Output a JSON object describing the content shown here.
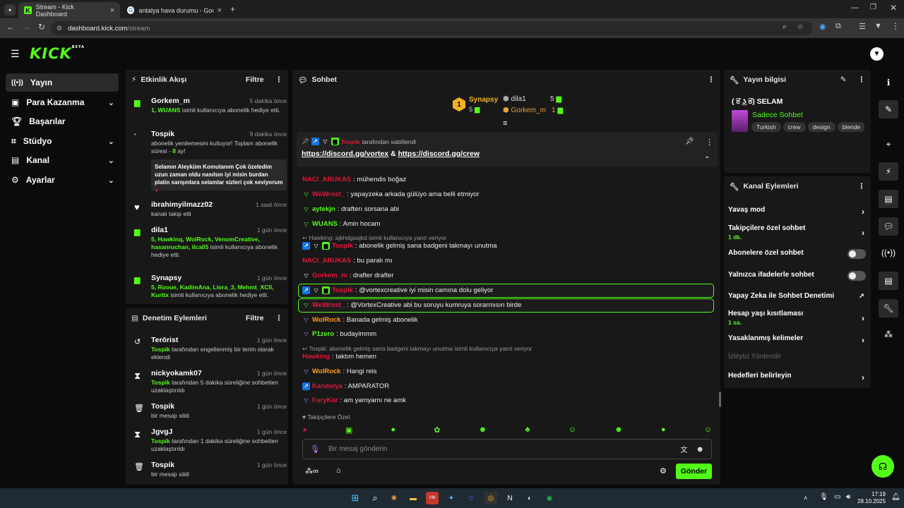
{
  "browser": {
    "tabs": [
      {
        "title": "Stream - Kick Dashboard"
      },
      {
        "title": "antalya hava durumu - Google"
      }
    ],
    "url_host": "dashboard.kick.com",
    "url_path": "/stream"
  },
  "kick": {
    "logo": "KICK",
    "beta": "BETA"
  },
  "nav": {
    "items": [
      {
        "label": "Yayın",
        "icon": "broadcast-icon"
      },
      {
        "label": "Para Kazanma",
        "icon": "money-icon"
      },
      {
        "label": "Başarılar",
        "icon": "trophy-icon"
      },
      {
        "label": "Stüdyo",
        "icon": "studio-icon"
      },
      {
        "label": "Kanal",
        "icon": "channel-icon"
      },
      {
        "label": "Ayarlar",
        "icon": "settings-icon"
      }
    ]
  },
  "activity": {
    "title": "Etkinlik Akışı",
    "filter": "Filtre",
    "events": [
      {
        "who": "Gorkem_m",
        "when": "5 dakika önce",
        "hl": "1, WUANS",
        "text": " isimli kullanıcıya abonelik hediye etti."
      },
      {
        "who": "Tospik",
        "when": "9 dakika önce",
        "text1": "abonelik yenilemesini kutluyor! Toplam abonelik süresi - ",
        "hl": "8",
        "text2": " ay!",
        "message": "Selamın Aleyküm Komutanım Çok özeledim uzun zaman oldu nasılsın iyi misin burdan platin sarışınlara selamlar sizleri çok seviyorum"
      },
      {
        "who": "ibrahimyilmazz02",
        "when": "1 saat önce",
        "text": "kanalı takip etti"
      },
      {
        "who": "dila1",
        "when": "1 gün önce",
        "hl": "5, Hawkinq, WolRock, VenomCreative, hasanruchan, ilca05",
        "text": "isimli kullanıcıya abonelik hediye etti."
      },
      {
        "who": "Synapsy",
        "when": "1 gün önce",
        "hl": "5, Rooue, KadimAna, Liora_3, Mehmt_XClI, Kurttx",
        "text": "isimli kullanıcıya abonelik hediye etti."
      }
    ]
  },
  "moderation": {
    "title": "Denetim Eylemleri",
    "filter": "Filtre",
    "items": [
      {
        "who": "Terörist",
        "when": "1 gün önce",
        "by": "Tospik",
        "text": " tarafından engellenmiş bir terim olarak eklendi"
      },
      {
        "who": "nickyokamk07",
        "when": "1 gün önce",
        "by": "Tospik",
        "text": " tarafından 5 dakika süreliğine sohbetten uzaklaştırıldı"
      },
      {
        "who": "Tospik",
        "when": "1 gün önce",
        "text": "bir mesajı sildi"
      },
      {
        "who": "JgvgJ",
        "when": "1 gün önce",
        "by": "Tospik",
        "text": " tarafından 1 dakika süreliğine sohbetten uzaklaştırıldı"
      },
      {
        "who": "Tospik",
        "when": "1 gün önce",
        "text": "bir mesajı sildi"
      }
    ]
  },
  "chat": {
    "title": "Sohbet",
    "leaderboard": {
      "first": {
        "rank": "1",
        "name": "Synapsy",
        "count": "5"
      },
      "second": {
        "name": "dila1",
        "count": "5"
      },
      "third": {
        "name": "Gorkem_m",
        "count": "1"
      }
    },
    "pinned": {
      "by": "Tospik",
      "suffix": " tarafından sabitlendi",
      "link1": "https://discord.gg/vortex",
      "amp": " & ",
      "link2": "https://discord.gg/crew"
    },
    "messages": [
      {
        "user": "NACI_ARUKAS",
        "color": "#e8133b",
        "text": ": mühendis boğaz"
      },
      {
        "user": "WeWrost_",
        "color": "#e8133b",
        "text": ": yapayzeka arkada gülüyo ama belli etmiyor"
      },
      {
        "user": "aytekjn",
        "color": "#53fc18",
        "text": ": drafterı sorsana abi"
      },
      {
        "user": "WUANS",
        "color": "#53fc18",
        "text": ": Amin hocam"
      },
      {
        "reply": "Hawking: ajkhdgasjkd isimli kullanıcıya yanıt veriyor"
      },
      {
        "user": "Tospik",
        "color": "#e8133b",
        "text": ": abonelik gelmiş sana badgeni takmayı unutma"
      },
      {
        "user": "NACI_ARUKAS",
        "color": "#e8133b",
        "text": ": bu paralı mı"
      },
      {
        "user": "Gorkem_m",
        "color": "#e8133b",
        "text": ": drafter drafter"
      },
      {
        "user": "Tospik",
        "color": "#e8133b",
        "text": ": @vortexcreative iyi misin camına dolu geliyor"
      },
      {
        "user": "WeWrost_",
        "color": "#e8133b",
        "text": ": @VortexCreative abi bu soruyu kumruya sorarmısın birde"
      },
      {
        "user": "WolRock",
        "color": "#ff9f1c",
        "text": ": Banada gelmiş abonelik"
      },
      {
        "user": "P1zero",
        "color": "#53fc18",
        "text": ": budayimmm"
      },
      {
        "reply": "Tospik: abonelik gelmiş sana badgeni takmayı unutma isimli kullanıcıya yanıt veriyor"
      },
      {
        "user": "Hawking",
        "color": "#e8133b",
        "text": ": taktım hemen"
      },
      {
        "user": "WolRock",
        "color": "#ff9f1c",
        "text": ": Hangi reis"
      },
      {
        "user": "Kandolya",
        "color": "#e8133b",
        "text": ": AMPARATOR"
      },
      {
        "user": "FuryKar",
        "color": "#e8133b",
        "text": ": am yamyamı ne amk"
      }
    ],
    "followers_only": "Takipçilere Özel",
    "input_placeholder": "Bir mesaj gönderin",
    "send": "Gönder"
  },
  "stream_info": {
    "title": "Yayın bilgisi",
    "stream_title": "( ͡ಠ ͜ʖ ͡ಠ) SELAM",
    "category": "Sadece Sohbet",
    "tags": [
      "Turkish",
      "crew",
      "design",
      "blende"
    ]
  },
  "channel_actions": {
    "title": "Kanal Eylemleri",
    "items": [
      {
        "label": "Yavaş mod",
        "type": "arrow"
      },
      {
        "label": "Takipçilere özel sohbet",
        "sub": "1 dk.",
        "type": "arrow"
      },
      {
        "label": "Abonelere özel sohbet",
        "type": "toggle",
        "on": false
      },
      {
        "label": "Yalnızca ifadelerle sohbet",
        "type": "toggle",
        "on": false
      },
      {
        "label": "Yapay Zeka ile Sohbet Denetimi",
        "type": "external"
      },
      {
        "label": "Hesap yaşı kısıtlaması",
        "sub": "1 sa.",
        "type": "arrow"
      },
      {
        "label": "Yasaklanmış kelimeler",
        "type": "arrow"
      },
      {
        "label": "İzleyici Yönlendir",
        "type": "disabled"
      },
      {
        "label": "Hedefleri belirleyin",
        "type": "arrow"
      }
    ]
  },
  "taskbar": {
    "time": "17:19",
    "date": "28.10.2025"
  },
  "colors": {
    "brand": "#53fc18",
    "panel": "#181818",
    "bg": "#0b0b0b"
  }
}
